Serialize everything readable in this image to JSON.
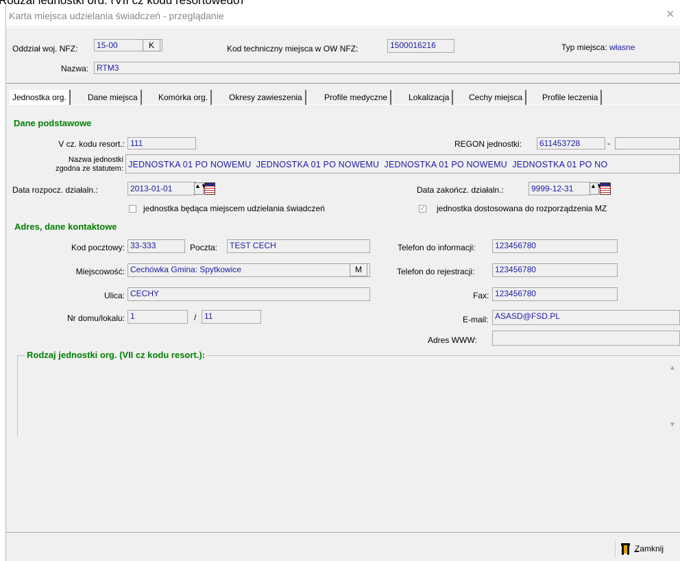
{
  "top_clip": "Rodzaj jednostki org. (VII cz kodu resortowego)",
  "window": {
    "title": "Karta miejsca udzielania świadczeń - przeglądanie",
    "close_glyph": "×"
  },
  "header": {
    "oddzial_label": "Oddział woj. NFZ:",
    "oddzial_value": "15-00",
    "k_button": "K",
    "kod_label": "Kod techniczny miejsca w OW NFZ:",
    "kod_value": "1500016216",
    "typ_label": "Typ miejsca:",
    "typ_value": "własne",
    "nazwa_label": "Nazwa:",
    "nazwa_value": "RTM3"
  },
  "tabs": [
    {
      "label": "Jednostka org."
    },
    {
      "label": "Dane miejsca"
    },
    {
      "label": "Komórka org."
    },
    {
      "label": "Okresy zawieszenia"
    },
    {
      "label": "Profile medyczne"
    },
    {
      "label": "Lokalizacja"
    },
    {
      "label": "Cechy miejsca"
    },
    {
      "label": "Profile leczenia"
    }
  ],
  "dane_podstawowe": {
    "title": "Dane podstawowe",
    "v_label": "V cz. kodu resort.:",
    "v_value": "111",
    "regon_label": "REGON jednostki:",
    "regon_value": "611453728",
    "regon_sep": "-",
    "regon_suffix": "",
    "nazwa_label_1": "Nazwa jednostki",
    "nazwa_label_2": "zgodna ze statutem:",
    "nazwa_value": "JEDNOSTKA 01 PO NOWEMU  JEDNOSTKA 01 PO NOWEMU  JEDNOSTKA 01 PO NOWEMU  JEDNOSTKA 01 PO NO",
    "data_rozp_label": "Data rozpocz. działaln.:",
    "data_rozp_value": "2013-01-01",
    "data_zak_label": "Data zakończ. działaln.:",
    "data_zak_value": "9999-12-31",
    "chk1_label": "jednostka będąca miejscem udzielania świadczeń",
    "chk2_label": "jednostka dostosowana do rozporządzenia MZ",
    "chk2_mark": "✓",
    "spin_glyph": "▲▼"
  },
  "adres": {
    "title": "Adres, dane kontaktowe",
    "kod_label": "Kod pocztowy:",
    "kod_value": "33-333",
    "poczta_label": "Poczta:",
    "poczta_value": "TEST CECH",
    "miejsc_label": "Miejscowość:",
    "miejsc_value": "Cechówka Gmina: Spytkowice",
    "m_button": "M",
    "ulica_label": "Ulica:",
    "ulica_value": "CECHY",
    "nr_label": "Nr domu/lokalu:",
    "nr_dom": "1",
    "nr_sep": "/",
    "nr_lok": "11",
    "tel_info_label": "Telefon do informacji:",
    "tel_info_value": "123456780",
    "tel_rej_label": "Telefon do rejestracji:",
    "tel_rej_value": "123456780",
    "fax_label": "Fax:",
    "fax_value": "123456780",
    "email_label": "E-mail:",
    "email_value": "ASASD@FSD.PL",
    "www_label": "Adres WWW:",
    "www_value": ""
  },
  "rodzaj": {
    "title": "Rodzaj jednostki org. (VII cz kodu resort.):",
    "scroll_up": "▲",
    "scroll_down": "▼"
  },
  "footer": {
    "close_button": "Zamknij"
  }
}
